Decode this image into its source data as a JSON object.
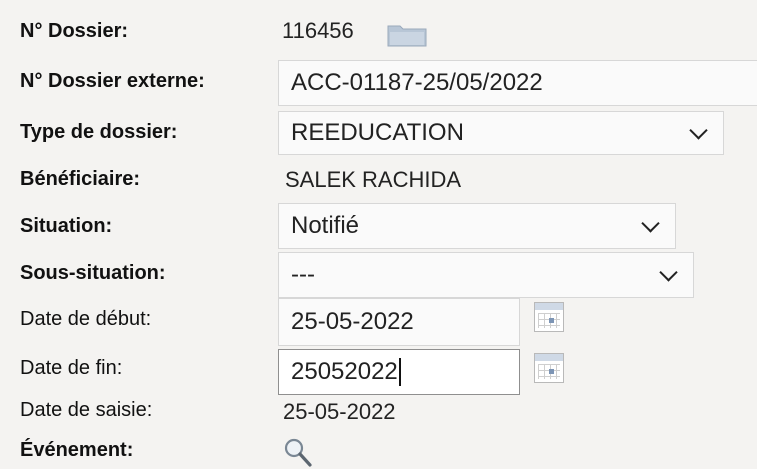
{
  "form": {
    "dossier": {
      "label": "N° Dossier:",
      "value": "116456"
    },
    "external": {
      "label": "N° Dossier externe:",
      "value": "ACC-01187-25/05/2022"
    },
    "type": {
      "label": "Type de dossier:",
      "value": "REEDUCATION"
    },
    "beneficiary": {
      "label": "Bénéficiaire:",
      "value": "SALEK RACHIDA"
    },
    "situation": {
      "label": "Situation:",
      "value": "Notifié"
    },
    "subsituation": {
      "label": "Sous-situation:",
      "value": "---"
    },
    "start_date": {
      "label": "Date de début:",
      "value": "25-05-2022"
    },
    "end_date": {
      "label": "Date de fin:",
      "value": "25052022"
    },
    "entry_date": {
      "label": "Date de saisie:",
      "value": "25-05-2022"
    },
    "event": {
      "label": "Événement:"
    }
  },
  "icons": {
    "folder": "folder-icon",
    "calendar": "calendar-icon",
    "search": "search-icon",
    "dropdown": "chevron-down-icon"
  }
}
